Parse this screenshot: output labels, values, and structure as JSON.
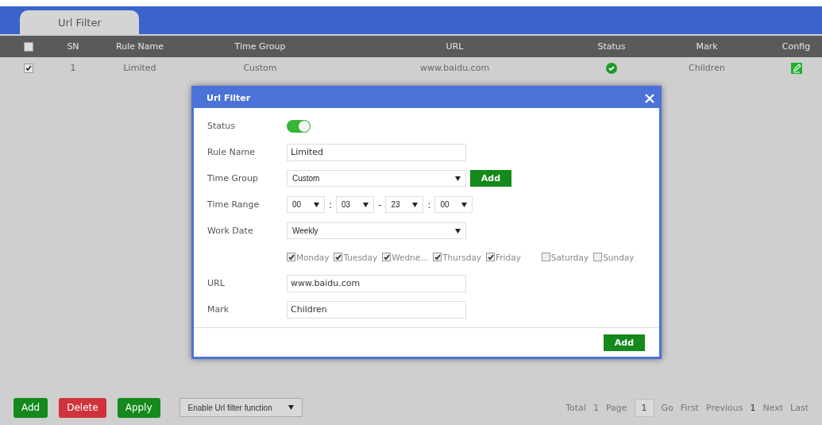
{
  "tabs": [
    {
      "label": "Url Filter",
      "selected": true
    }
  ],
  "table": {
    "select_all": {
      "checked": false
    },
    "columns": [
      "SN",
      "Rule Name",
      "Time Group",
      "URL",
      "Status",
      "Mark",
      "Config"
    ],
    "rows": [
      {
        "checked": true,
        "sn": "1",
        "rule_name": "Limited",
        "time_group": "Custom",
        "url": "www.baidu.com",
        "enabled": true,
        "mark": "Children"
      }
    ]
  },
  "dialog": {
    "title": "Url Filter",
    "status": {
      "label": "Status",
      "on": true
    },
    "rule_name": {
      "label": "Rule Name",
      "value": "Limited"
    },
    "time_group": {
      "label": "Time Group",
      "value": "Custom",
      "button": "Add"
    },
    "time_range": {
      "label": "Time Range",
      "start_hour": "00",
      "start_minute": "03",
      "colon": ":",
      "dash": "-",
      "end_hour": "23",
      "end_minute": "00"
    },
    "work_date": {
      "label": "Work Date",
      "value": "Weekly"
    },
    "days": [
      {
        "label": "Monday",
        "checked": true
      },
      {
        "label": "Tuesday",
        "checked": true
      },
      {
        "label": "Wedne...",
        "checked": true
      },
      {
        "label": "Thursday",
        "checked": true
      },
      {
        "label": "Friday",
        "checked": true
      },
      {
        "label": "Saturday",
        "checked": false
      },
      {
        "label": "Sunday",
        "checked": false
      }
    ],
    "url": {
      "label": "URL",
      "value": "www.baidu.com"
    },
    "mark": {
      "label": "Mark",
      "value": "Children"
    },
    "submit": "Add"
  },
  "footer": {
    "buttons": [
      {
        "label": "Add",
        "kind": "primary"
      },
      {
        "label": "Delete",
        "kind": "danger"
      },
      {
        "label": "Apply",
        "kind": "primary"
      }
    ],
    "function_select": "Enable Url filter function",
    "pagination": {
      "total_label": "Total",
      "total": "1",
      "page_label": "Page",
      "page": "1",
      "go": "Go",
      "first": "First",
      "previous": "Previous",
      "current": "1",
      "next": "Next",
      "last": "Last"
    }
  }
}
